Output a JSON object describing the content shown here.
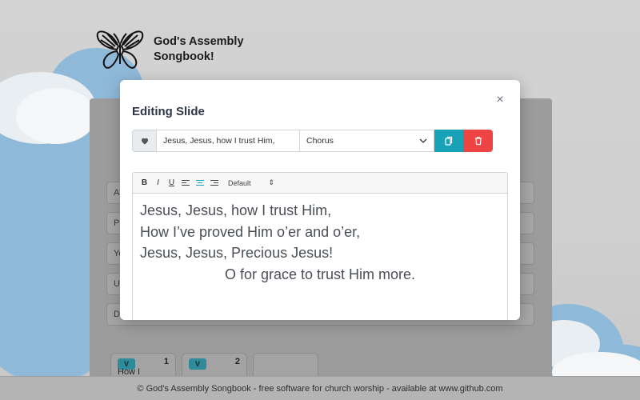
{
  "brand": {
    "title": "God's Assembly Songbook!"
  },
  "background_form": {
    "fields": [
      {
        "label": "A"
      },
      {
        "label": "P"
      },
      {
        "label": "Ye"
      },
      {
        "label": "U"
      },
      {
        "label": "D"
      }
    ],
    "tiles": [
      {
        "badge": "V",
        "number": "1",
        "text": "How I Jesu"
      },
      {
        "badge": "V",
        "number": "2",
        "text": ""
      }
    ]
  },
  "modal": {
    "title": "Editing Slide",
    "close_icon": "×",
    "line_value": "Jesus, Jesus, how I trust Him,",
    "type_selected": "Chorus",
    "icons": {
      "favorite": "heart-icon",
      "copy": "copy-icon",
      "delete": "trash-icon"
    },
    "colors": {
      "copy": "#17a2b8",
      "delete": "#ef4444",
      "active_align": "#17a2b8"
    }
  },
  "editor": {
    "toolbar": {
      "bold": "B",
      "italic": "I",
      "underline": "U",
      "size": "Default",
      "size_chevron": "⇕"
    },
    "lines": [
      "Jesus, Jesus, how I trust Him,",
      "How I’ve proved Him o’er and o’er,",
      "Jesus, Jesus, Precious Jesus!",
      "O for grace to trust Him more."
    ]
  },
  "footer": {
    "text": "© God's Assembly Songbook - free software for church worship - available at www.github.com"
  }
}
